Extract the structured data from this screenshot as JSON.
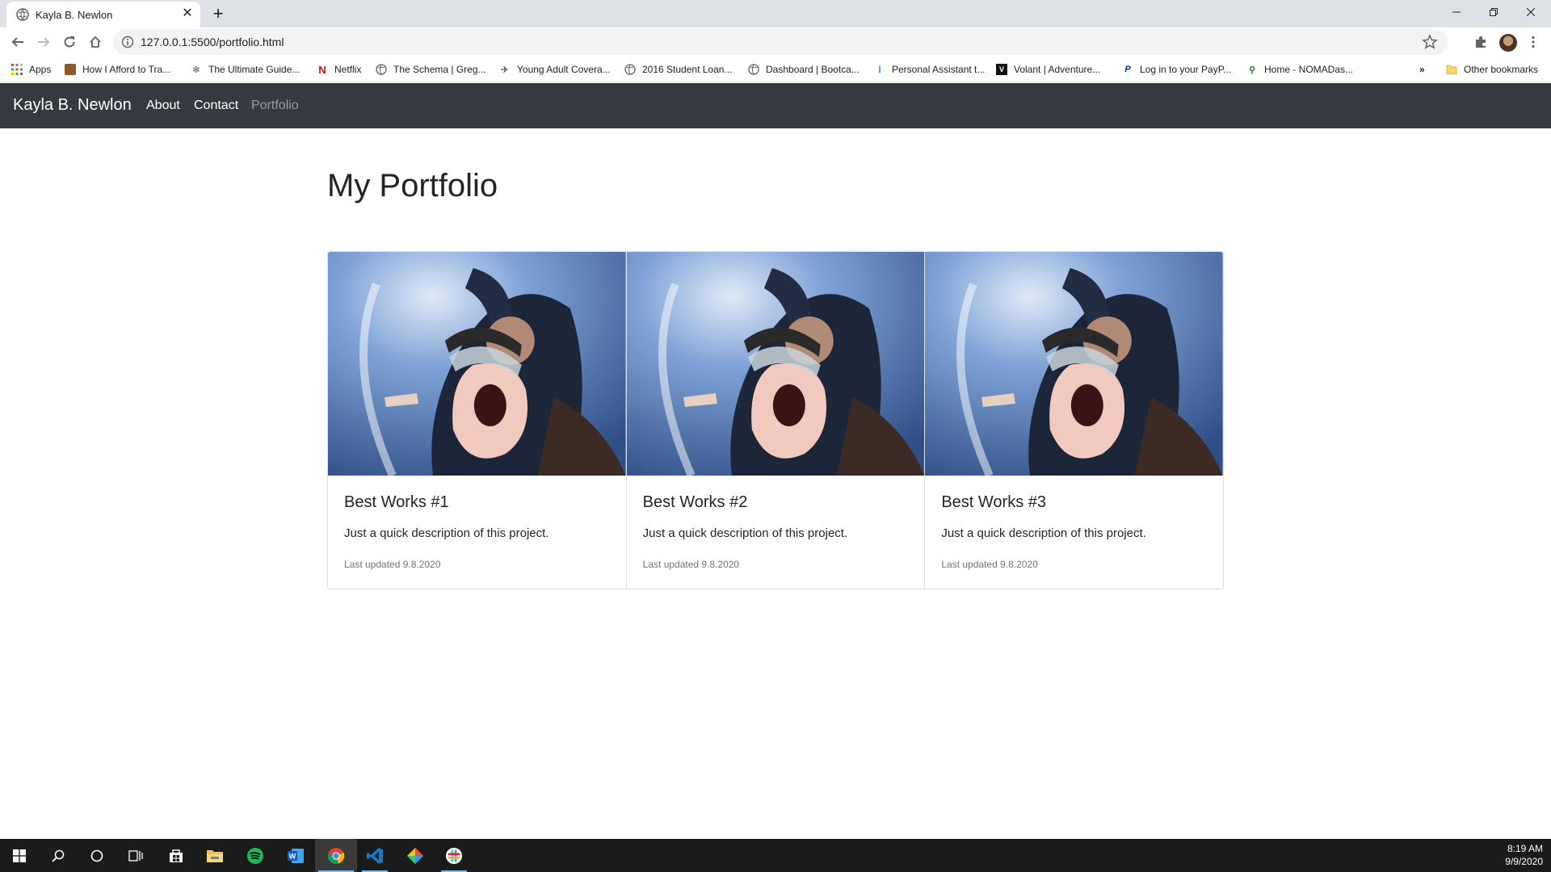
{
  "browser": {
    "tab": {
      "title": "Kayla B. Newlon"
    },
    "url": "127.0.0.1:5500/portfolio.html",
    "bookmarks": [
      {
        "label": "Apps",
        "icon": "apps-grid-icon"
      },
      {
        "label": "How I Afford to Tra...",
        "icon": "site-favicon"
      },
      {
        "label": "The Ultimate Guide...",
        "icon": "palm-tree-icon"
      },
      {
        "label": "Netflix",
        "icon": "netflix-icon"
      },
      {
        "label": "The Schema | Greg...",
        "icon": "globe-icon"
      },
      {
        "label": "Young Adult Covera...",
        "icon": "plane-icon"
      },
      {
        "label": "2016 Student Loan...",
        "icon": "globe-icon"
      },
      {
        "label": "Dashboard | Bootca...",
        "icon": "globe-icon"
      },
      {
        "label": "Personal Assistant t...",
        "icon": "info-icon"
      },
      {
        "label": "Volant | Adventure...",
        "icon": "volant-icon"
      },
      {
        "label": "Log in to your PayP...",
        "icon": "paypal-icon"
      },
      {
        "label": "Home - NOMADas...",
        "icon": "runner-icon"
      }
    ],
    "overflow_label": "»",
    "other_bookmarks": "Other bookmarks"
  },
  "site": {
    "brand": "Kayla B. Newlon",
    "nav": [
      {
        "label": "About",
        "active": false
      },
      {
        "label": "Contact",
        "active": false
      },
      {
        "label": "Portfolio",
        "active": true
      }
    ]
  },
  "main": {
    "title": "My Portfolio",
    "cards": [
      {
        "title": "Best Works #1",
        "text": "Just a quick description of this project.",
        "updated": "Last updated 9.8.2020"
      },
      {
        "title": "Best Works #2",
        "text": "Just a quick description of this project.",
        "updated": "Last updated 9.8.2020"
      },
      {
        "title": "Best Works #3",
        "text": "Just a quick description of this project.",
        "updated": "Last updated 9.8.2020"
      }
    ]
  },
  "taskbar": {
    "time": "8:19 AM",
    "date": "9/9/2020",
    "apps": [
      "windows-start-icon",
      "search-icon",
      "cortana-icon",
      "task-view-icon",
      "store-icon",
      "file-explorer-icon",
      "spotify-icon",
      "word-icon",
      "chrome-icon",
      "vscode-icon",
      "git-icon",
      "slack-icon"
    ]
  },
  "colors": {
    "navbar": "#343a40",
    "nav_active": "#ffffff",
    "nav_inactive": "#9a9da0",
    "taskbar": "#1b1b1b",
    "tab_strip": "#dee1e6"
  }
}
